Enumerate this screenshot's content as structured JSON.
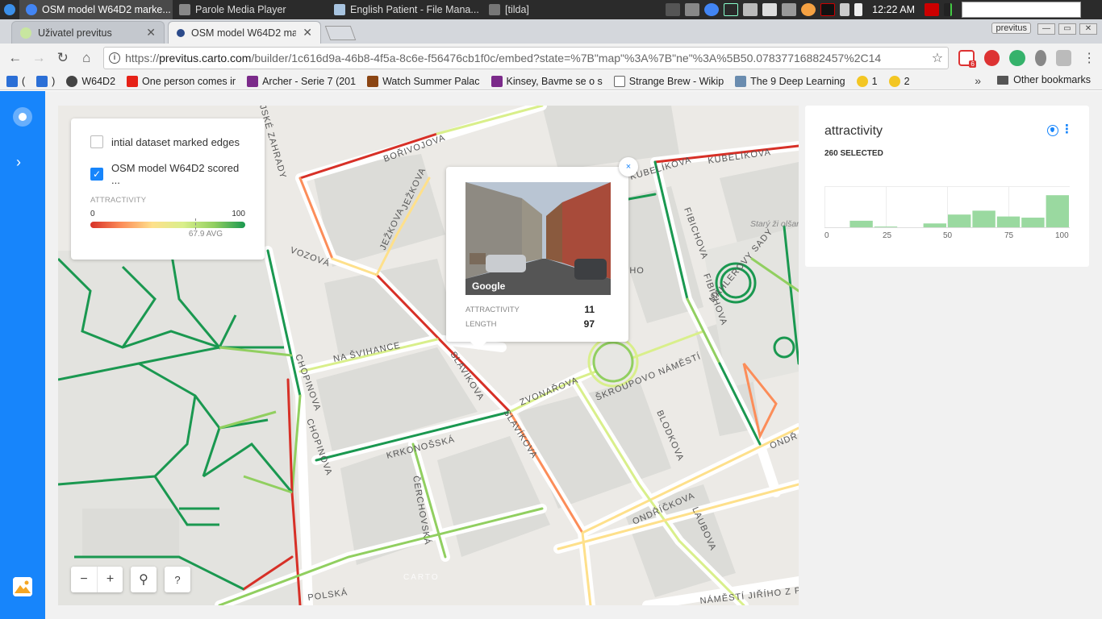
{
  "taskbar": {
    "apps": [
      {
        "label": "OSM model W64D2 marke...",
        "active": true,
        "icon_color": "#4285f4"
      },
      {
        "label": "Parole Media Player",
        "active": false,
        "icon_color": "#888"
      },
      {
        "label": "English Patient - File Mana...",
        "active": false,
        "icon_color": "#a8c4e0"
      },
      {
        "label": "[tilda]",
        "active": false,
        "icon_color": "#777"
      }
    ],
    "clock": "12:22 AM"
  },
  "browser": {
    "tabs": [
      {
        "label": "Uživatel previtus",
        "active": false
      },
      {
        "label": "OSM model W64D2 ma",
        "active": true
      }
    ],
    "profile": "previtus",
    "url_prefix": "https://",
    "url_host": "previtus.carto.com",
    "url_path": "/builder/1c616d9a-46b8-4f5a-8c6e-f56476cb1f0c/embed?state=%7B\"map\"%3A%7B\"ne\"%3A%5B50.07837716882457%2C14",
    "bookmarks": [
      {
        "label": "(",
        "icon_color": "#2b6fd6"
      },
      {
        "label": ")",
        "icon_color": "#2b6fd6"
      },
      {
        "label": "W64D2",
        "icon_color": "#444"
      },
      {
        "label": "One person comes ir",
        "icon_color": "#e62117"
      },
      {
        "label": "Archer - Serie 7 (201",
        "icon_color": "#7b2a8a"
      },
      {
        "label": "Watch Summer Palac",
        "icon_color": "#8b4513"
      },
      {
        "label": "Kinsey, Bavme se o s",
        "icon_color": "#7b2a8a"
      },
      {
        "label": "Strange Brew - Wikip",
        "icon_color": "#ddd"
      },
      {
        "label": "The 9 Deep Learning",
        "icon_color": "#6a8caf"
      },
      {
        "label": "1",
        "icon_color": "#f3c623"
      },
      {
        "label": "2",
        "icon_color": "#f3c623"
      }
    ],
    "bookmarks_more": "»",
    "other_bookmarks": "Other bookmarks",
    "ext_badge": "6"
  },
  "legend": {
    "layer1": "intial dataset marked edges",
    "layer2": "OSM model W64D2 scored ...",
    "title": "ATTRACTIVITY",
    "min": "0",
    "max": "100",
    "avg": "67.9 AVG",
    "avg_value": 67.9
  },
  "popup": {
    "key1": "ATTRACTIVITY",
    "val1": "11",
    "key2": "LENGTH",
    "val2": "97",
    "image_label": "Google",
    "close": "×"
  },
  "map": {
    "streets": [
      "BOŘIVOJOVA",
      "JEŽKOVA",
      "JEŽKOVA",
      "VOZOVÁ",
      "NA ŠVIHANCE",
      "SLAVÍKOVA",
      "SLAVÍKOVA",
      "ZVONAŘOVA",
      "ŠKROUPOVO NÁMĚSTÍ",
      "CHOPINOVA",
      "CHOPINOVA",
      "KRKONOŠSKÁ",
      "ČERCHOVSKÁ",
      "BLODKOVA",
      "ONDŘÍČKOVA",
      "LAUBOVA",
      "FIBICHOVA",
      "FIBICHOVA",
      "MAHLEROVY SADY",
      "KUBELÍKOVA",
      "KUBELÍKOVA",
      "POLSKÁ",
      "NÁMĚSTÍ JIŘÍHO Z P",
      "ONDŘ",
      "JSKÉ ZAHRADY",
      "ĚHO"
    ],
    "park_label": "Starý ži olšanský",
    "watermark": "CARTO"
  },
  "zoom": {
    "minus": "−",
    "plus": "+",
    "search": "⚲",
    "help": "?"
  },
  "widget": {
    "title": "attractivity",
    "selected": "260 SELECTED",
    "menu": "⋮",
    "ticks": [
      "0",
      "25",
      "50",
      "75",
      "100"
    ]
  },
  "chart_data": {
    "type": "bar",
    "title": "attractivity",
    "bins": [
      [
        0,
        10
      ],
      [
        10,
        20
      ],
      [
        20,
        30
      ],
      [
        30,
        40
      ],
      [
        40,
        50
      ],
      [
        50,
        60
      ],
      [
        60,
        70
      ],
      [
        70,
        80
      ],
      [
        80,
        90
      ],
      [
        90,
        100
      ]
    ],
    "values": [
      2,
      19,
      4,
      0,
      12,
      35,
      45,
      30,
      27,
      85
    ],
    "xlabel": "",
    "ylabel": "",
    "xlim": [
      0,
      100
    ],
    "color": "#9ad9a0"
  }
}
